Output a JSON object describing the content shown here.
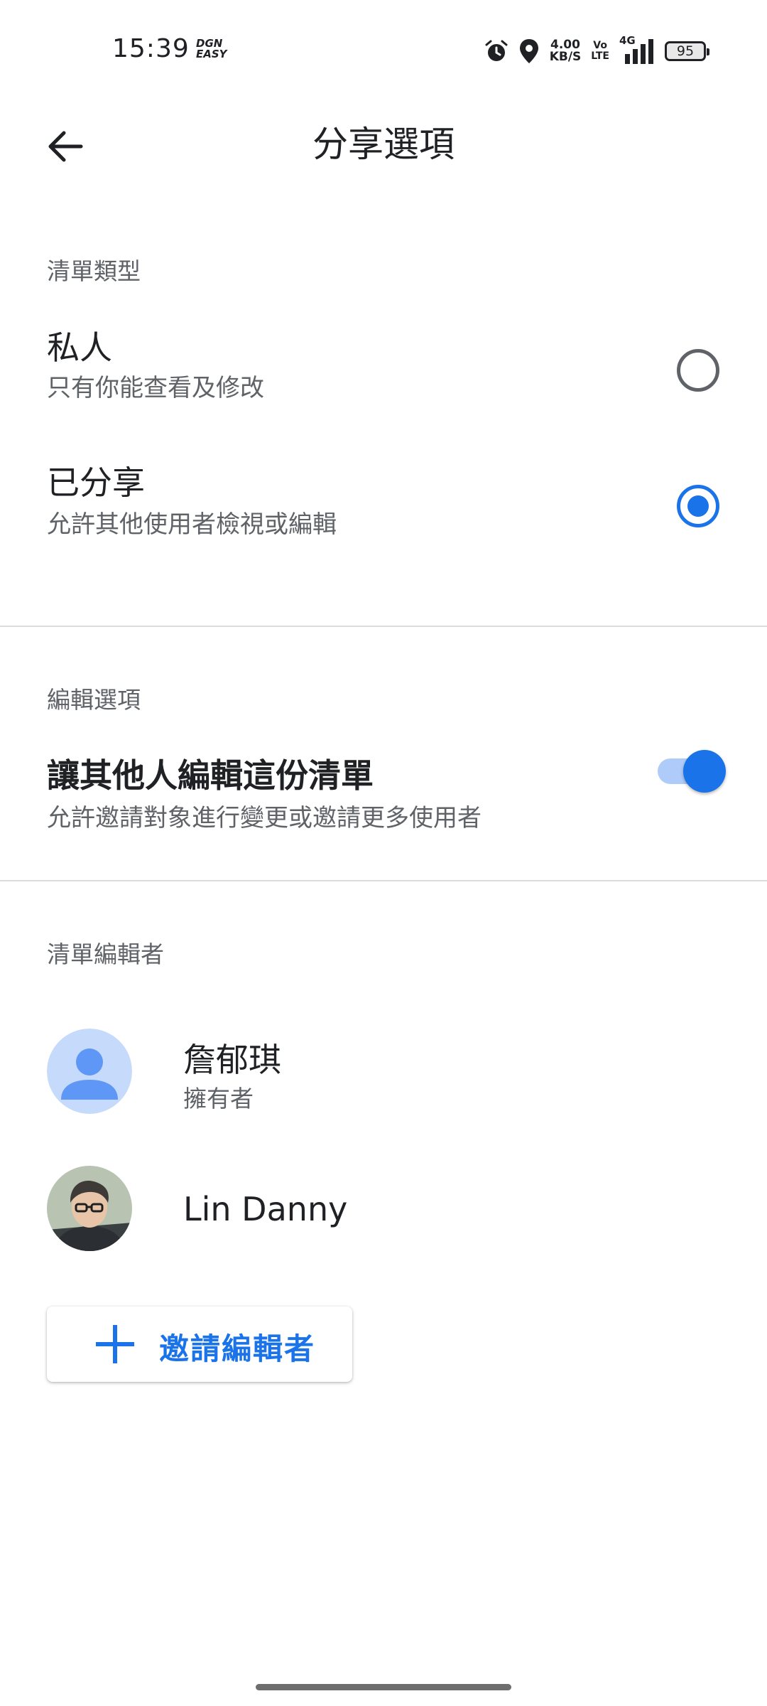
{
  "status_bar": {
    "time": "15:39",
    "app_badge": "DGN EASY",
    "speed_value": "4.00",
    "speed_unit": "KB/S",
    "volte_top": "Vo",
    "volte_bottom": "LTE",
    "network": "4G",
    "battery": "95"
  },
  "header": {
    "title": "分享選項"
  },
  "list_type": {
    "section_label": "清單類型",
    "options": [
      {
        "title": "私人",
        "subtitle": "只有你能查看及修改",
        "selected": false
      },
      {
        "title": "已分享",
        "subtitle": "允許其他使用者檢視或編輯",
        "selected": true
      }
    ]
  },
  "edit_options": {
    "section_label": "編輯選項",
    "title": "讓其他人編輯這份清單",
    "subtitle": "允許邀請對象進行變更或邀請更多使用者",
    "enabled": true
  },
  "editors": {
    "section_label": "清單編輯者",
    "items": [
      {
        "name": "詹郁琪",
        "role": "擁有者",
        "avatar": "default-person-avatar"
      },
      {
        "name": "Lin Danny",
        "role": "",
        "avatar": "photo-avatar"
      }
    ],
    "invite_label": "邀請編輯者"
  },
  "colors": {
    "accent": "#1a73e8",
    "accent_light": "#aecbfa",
    "text_primary": "#202124",
    "text_secondary": "#5f6368",
    "divider": "#dadce0"
  }
}
